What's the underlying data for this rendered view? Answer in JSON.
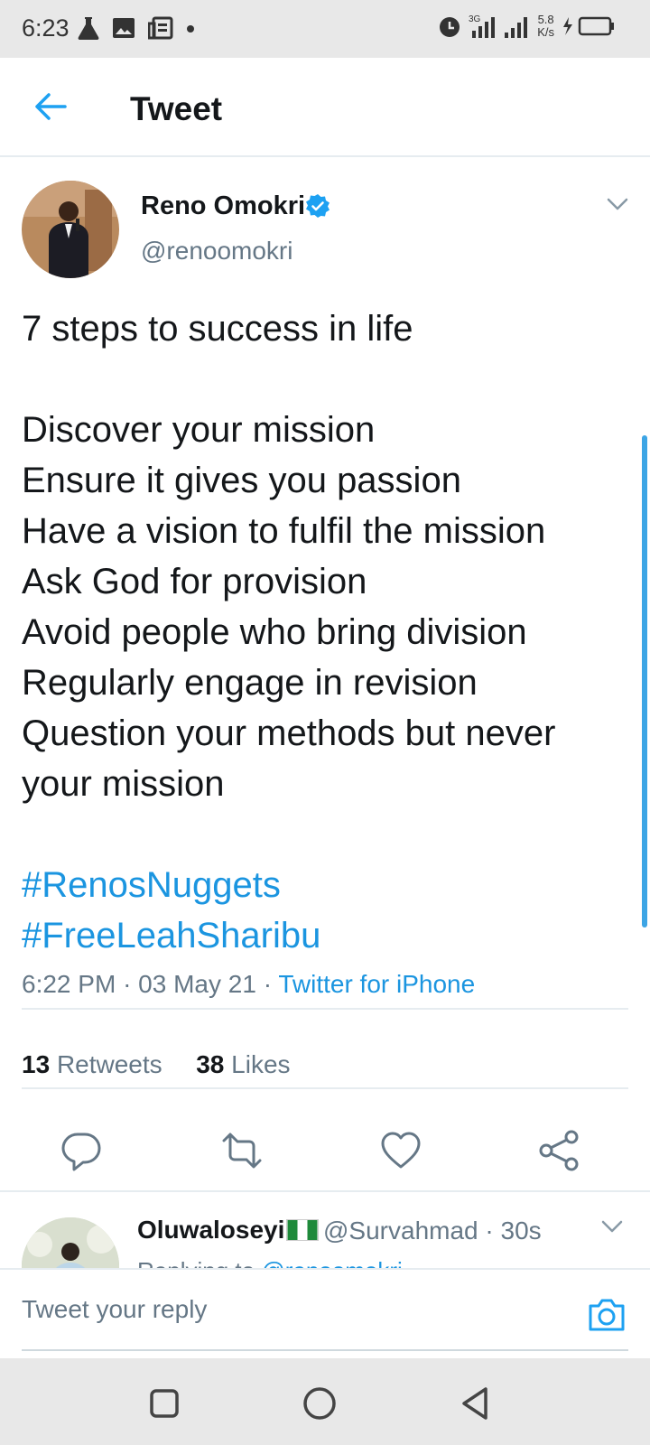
{
  "status_bar": {
    "time": "6:23",
    "left_icons": [
      "flask-icon",
      "image-icon",
      "news-icon",
      "dot-icon"
    ],
    "right_icons": [
      "alarm-icon",
      "signal-3g-icon",
      "signal-icon",
      "battery-charging-icon"
    ],
    "net_speed_value": "5.8",
    "net_speed_unit": "K/s"
  },
  "app_bar": {
    "back_icon": "arrow-left-icon",
    "title": "Tweet"
  },
  "tweet": {
    "author_name": "Reno Omokri",
    "verified_icon": "verified-badge-icon",
    "handle": "@renoomokri",
    "more_icon": "chevron-down-icon",
    "lines": [
      "7 steps to success in life",
      "",
      "Discover your mission",
      "Ensure it gives you passion",
      "Have a vision to fulfil the mission",
      "Ask God for provision",
      "Avoid people who bring division",
      "Regularly engage in revision",
      "Question your methods but never",
      "your mission",
      ""
    ],
    "hashtags": [
      "#RenosNuggets",
      "#FreeLeahSharibu"
    ],
    "time": "6:22 PM",
    "date": "03 May 21",
    "source": "Twitter for iPhone",
    "retweets_count": "13",
    "retweets_label": "Retweets",
    "likes_count": "38",
    "likes_label": "Likes",
    "actions": [
      "reply-icon",
      "retweet-icon",
      "like-icon",
      "share-icon"
    ]
  },
  "reply_preview": {
    "name": "Oluwaloseyi",
    "handle_time": "@Survahmad · 30s",
    "replying_prefix": "Replying to",
    "replying_user": "@renoomokri"
  },
  "reply_box": {
    "placeholder": "Tweet your reply",
    "camera_icon": "camera-icon"
  },
  "colors": {
    "accent": "#1b95e0",
    "text": "#14171a",
    "secondary": "#657786",
    "divider": "#e6ecf0"
  },
  "nav_bar": {
    "icons": [
      "recents-square-icon",
      "home-circle-icon",
      "back-triangle-icon"
    ]
  }
}
